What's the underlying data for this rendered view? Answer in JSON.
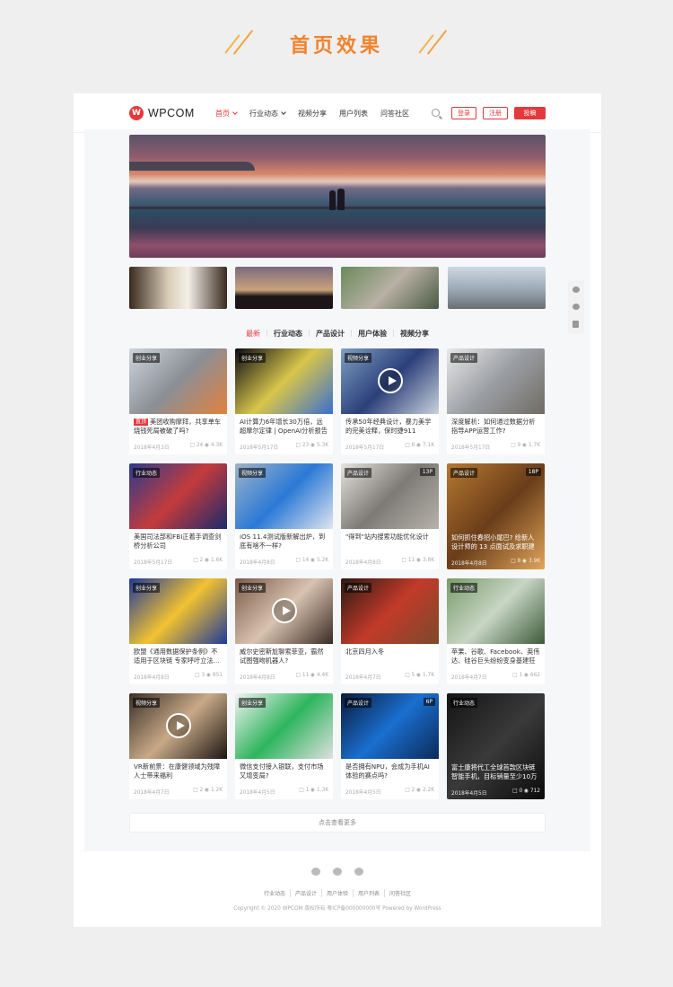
{
  "banner": {
    "title": "首页效果"
  },
  "header": {
    "logo_mark": "W",
    "logo_text": "WPCOM",
    "nav": [
      {
        "label": "首页",
        "active": true,
        "has_dropdown": true
      },
      {
        "label": "行业动态",
        "active": false,
        "has_dropdown": true
      },
      {
        "label": "视频分享",
        "active": false,
        "has_dropdown": false
      },
      {
        "label": "用户列表",
        "active": false,
        "has_dropdown": false
      },
      {
        "label": "问答社区",
        "active": false,
        "has_dropdown": false
      }
    ],
    "login_label": "登录",
    "register_label": "注册",
    "post_label": "投稿"
  },
  "tabs": [
    "最新",
    "行业动态",
    "产品设计",
    "用户体验",
    "视频分享"
  ],
  "cards": [
    {
      "category": "创业分享",
      "badge": "置顶",
      "title": "美团收购摩拜，共享单车烧钱死局被破了吗?",
      "date": "2018年4月3日",
      "comments": "24",
      "views": "4.3K",
      "count": "",
      "play": false,
      "full": false,
      "colors": [
        "#cfd5dc",
        "#8a8f96",
        "#e3823c"
      ]
    },
    {
      "category": "创业分享",
      "badge": "",
      "title": "AI计算力6年增长30万倍，远超摩尔定律 | OpenAI分析报告",
      "date": "2018年5月17日",
      "comments": "23",
      "views": "5.3K",
      "count": "",
      "play": false,
      "full": false,
      "colors": [
        "#0a0a14",
        "#d8c64a",
        "#3a6fd0"
      ]
    },
    {
      "category": "视频分享",
      "badge": "",
      "title": "传承50年经典设计，暴力美学的完美诠释，保时捷911 Targa 4 GTS",
      "date": "2018年5月17日",
      "comments": "8",
      "views": "7.1K",
      "count": "",
      "play": true,
      "full": false,
      "colors": [
        "#7ea0c2",
        "#2b3f7a",
        "#c9d3dc"
      ]
    },
    {
      "category": "产品设计",
      "badge": "",
      "title": "深度解析：如何通过数据分析指导APP运营工作?",
      "date": "2018年5月17日",
      "comments": "9",
      "views": "1.7K",
      "count": "",
      "play": false,
      "full": false,
      "colors": [
        "#e8e8e6",
        "#9a9ea3",
        "#6f6b63"
      ]
    },
    {
      "category": "行业动态",
      "badge": "",
      "title": "美国司法部和FBI正着手调查剑桥分析公司",
      "date": "2018年5月17日",
      "comments": "2",
      "views": "1.6K",
      "count": "",
      "play": false,
      "full": false,
      "colors": [
        "#2a3b8f",
        "#c43b3b",
        "#1a2a6a"
      ]
    },
    {
      "category": "视频分享",
      "badge": "",
      "title": "iOS 11.4测试版新解出炉，到底有啥不一样?",
      "date": "2018年4月8日",
      "comments": "14",
      "views": "5.2K",
      "count": "",
      "play": false,
      "full": false,
      "colors": [
        "#9fb3c8",
        "#2b79d6",
        "#dfe6ee"
      ]
    },
    {
      "category": "产品设计",
      "badge": "",
      "title": "\"得到\"站内搜索功能优化设计",
      "date": "2018年4月8日",
      "comments": "11",
      "views": "3.8K",
      "count": "13P",
      "play": false,
      "full": false,
      "colors": [
        "#e6e4df",
        "#7e7b76",
        "#b6b2aa"
      ]
    },
    {
      "category": "产品设计",
      "badge": "",
      "title": "如何抓住春招小尾巴? 给新人设计师的 13 点面试及求职建议",
      "date": "2018年4月8日",
      "comments": "8",
      "views": "3.9K",
      "count": "18P",
      "play": false,
      "full": true,
      "colors": [
        "#b5782f",
        "#6a3d1a",
        "#e0a55a"
      ]
    },
    {
      "category": "创业分享",
      "badge": "",
      "title": "欧盟《通用数据保护条例》不适用于区块链 专家呼吁立法...",
      "date": "2018年4月8日",
      "comments": "3",
      "views": "851",
      "count": "",
      "play": false,
      "full": false,
      "colors": [
        "#1e3a9a",
        "#f2c230",
        "#1e3a9a"
      ]
    },
    {
      "category": "创业分享",
      "badge": "",
      "title": "威尔史密斯尬聊索菲亚，霸然试图强吻机器人?",
      "date": "2018年4月8日",
      "comments": "11",
      "views": "4.4K",
      "count": "",
      "play": true,
      "full": false,
      "colors": [
        "#7a5a48",
        "#d8c3b0",
        "#3a2b24"
      ]
    },
    {
      "category": "产品设计",
      "badge": "",
      "title": "北京四月入冬",
      "date": "2018年4月7日",
      "comments": "5",
      "views": "1.7K",
      "count": "",
      "play": false,
      "full": false,
      "colors": [
        "#2a1a14",
        "#c23a2a",
        "#7b4a2c"
      ]
    },
    {
      "category": "行业动态",
      "badge": "",
      "title": "苹果、谷歌、Facebook、英伟达、硅谷巨头纷纷变身基建狂魔",
      "date": "2018年4月7日",
      "comments": "1",
      "views": "662",
      "count": "",
      "play": false,
      "full": false,
      "colors": [
        "#7a9a6a",
        "#c7d6c4",
        "#3e5a3a"
      ]
    },
    {
      "category": "视频分享",
      "badge": "",
      "title": "VR新前景：在康健领域为残障人士带来福利",
      "date": "2018年4月7日",
      "comments": "2",
      "views": "1.2K",
      "count": "",
      "play": true,
      "full": false,
      "colors": [
        "#3a2e28",
        "#c8a987",
        "#1c1612"
      ]
    },
    {
      "category": "创业分享",
      "badge": "",
      "title": "微信支付接入银联，支付市场又增变局?",
      "date": "2018年4月5日",
      "comments": "1",
      "views": "1.3K",
      "count": "",
      "play": false,
      "full": false,
      "colors": [
        "#f4f4f4",
        "#2db55d",
        "#e0e0e0"
      ]
    },
    {
      "category": "产品设计",
      "badge": "",
      "title": "是否拥有NPU，会成为手机AI体验的赛点吗?",
      "date": "2018年4月5日",
      "comments": "2",
      "views": "2.2K",
      "count": "6P",
      "play": false,
      "full": false,
      "colors": [
        "#0a1a3a",
        "#1a6fd0",
        "#0c2a5a"
      ]
    },
    {
      "category": "行业动态",
      "badge": "",
      "title": "富士康将代工全球首款区块链智能手机，目标销量至少10万",
      "date": "2018年4月5日",
      "comments": "0",
      "views": "712",
      "count": "",
      "play": false,
      "full": true,
      "colors": [
        "#141414",
        "#3a3a3a",
        "#0a0a0a"
      ]
    }
  ],
  "load_more": "点击查看更多",
  "footer": {
    "links": [
      "行业动态",
      "产品设计",
      "用户体验",
      "用户列表",
      "问答社区"
    ],
    "copyright": "Copyright © 2020 WPCOM 版权所有 粤ICP备000000000号 Powered by WordPress"
  }
}
